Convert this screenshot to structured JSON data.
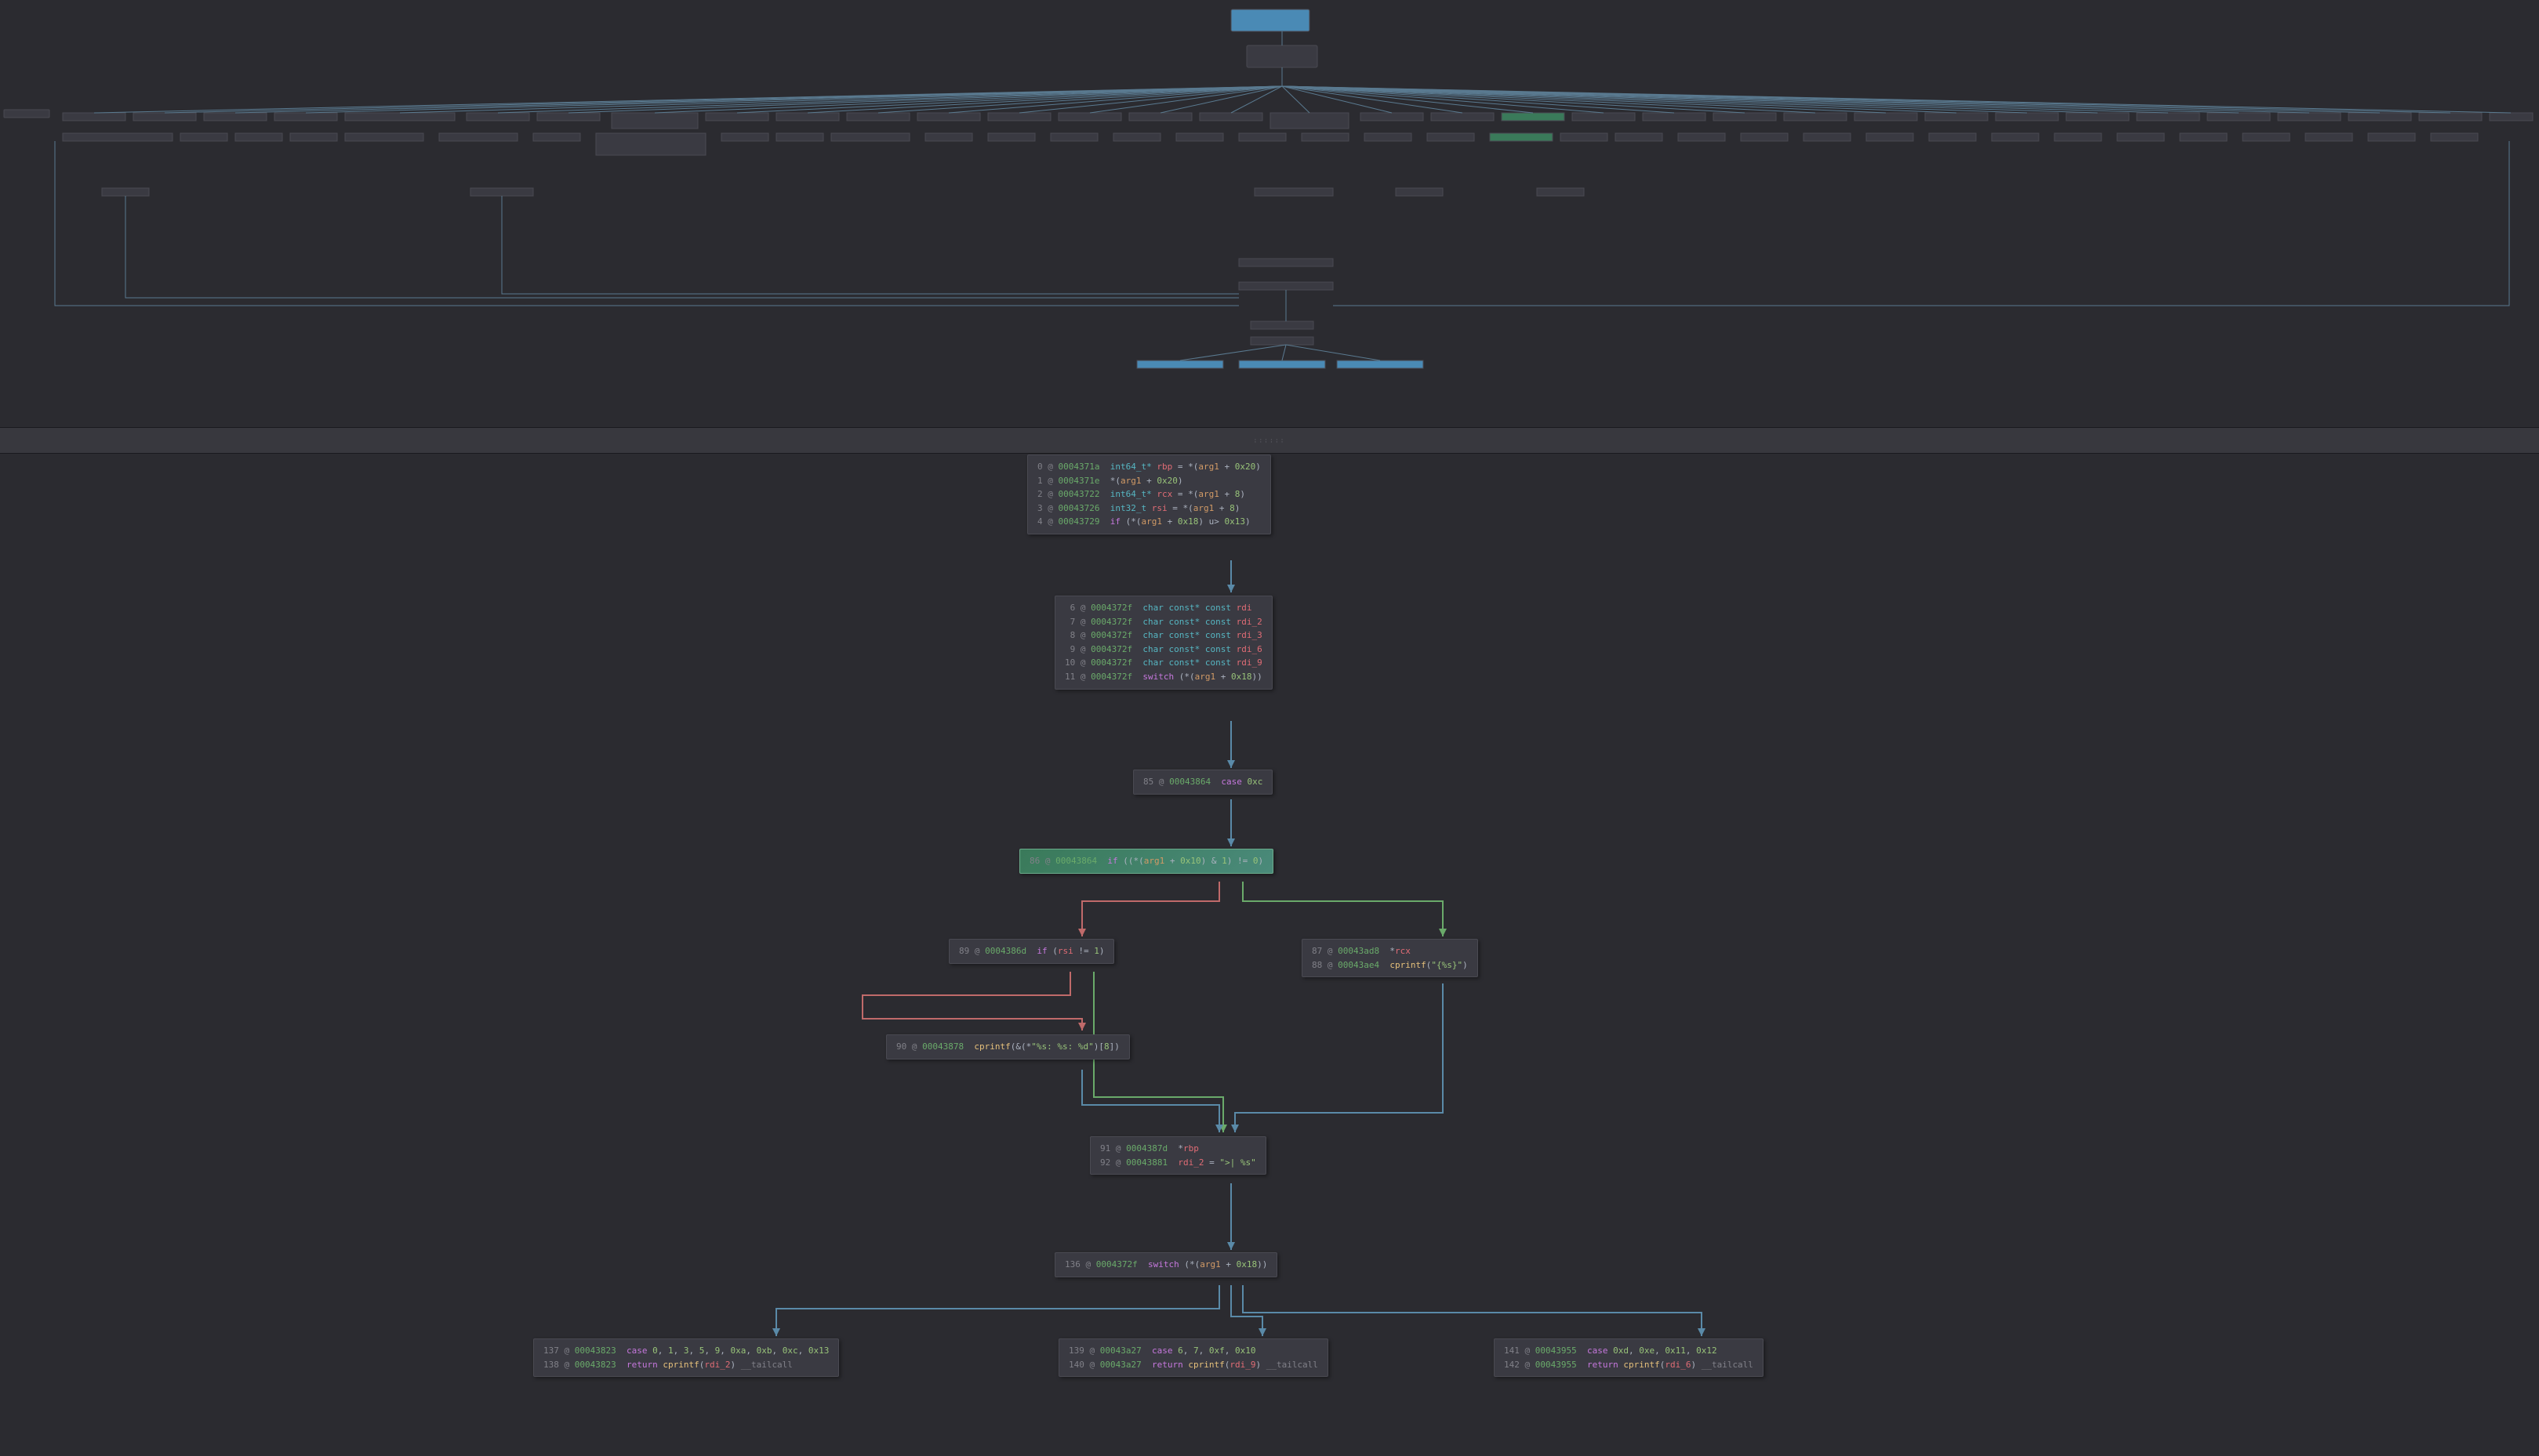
{
  "minimap": {
    "nodes_approx_count": 60,
    "highlighted_nodes": 2,
    "description": "overview graph with many small basic-block nodes and connecting edges at top of disassembler graph view"
  },
  "divider": {
    "handle_text": "::::::"
  },
  "blocks": {
    "b0": {
      "lines": [
        {
          "n": "0",
          "addr": "0004371a",
          "rest": [
            "int64_t* ",
            "rbp",
            " = *(",
            "arg1",
            " + ",
            "0x20",
            ")"
          ]
        },
        {
          "n": "1",
          "addr": "0004371e",
          "rest": [
            "*(",
            "arg1",
            " + ",
            "0x20",
            ")"
          ]
        },
        {
          "n": "2",
          "addr": "00043722",
          "rest": [
            "int64_t* ",
            "rcx",
            " = *(",
            "arg1",
            " + ",
            "8",
            ")"
          ]
        },
        {
          "n": "3",
          "addr": "00043726",
          "rest": [
            "int32_t ",
            "rsi",
            " = *(",
            "arg1",
            " + ",
            "8",
            ")"
          ]
        },
        {
          "n": "4",
          "addr": "00043729",
          "rest": [
            "if",
            " (*(",
            "arg1",
            " + ",
            "0x18",
            ") u> ",
            "0x13",
            ")"
          ]
        }
      ]
    },
    "b1": {
      "lines": [
        {
          "n": "6",
          "addr": "0004372f",
          "rest": [
            "char const* const ",
            "rdi"
          ]
        },
        {
          "n": "7",
          "addr": "0004372f",
          "rest": [
            "char const* const ",
            "rdi_2"
          ]
        },
        {
          "n": "8",
          "addr": "0004372f",
          "rest": [
            "char const* const ",
            "rdi_3"
          ]
        },
        {
          "n": "9",
          "addr": "0004372f",
          "rest": [
            "char const* const ",
            "rdi_6"
          ]
        },
        {
          "n": "10",
          "addr": "0004372f",
          "rest": [
            "char const* const ",
            "rdi_9"
          ]
        },
        {
          "n": "11",
          "addr": "0004372f",
          "rest": [
            "switch",
            " (*(",
            "arg1",
            " + ",
            "0x18",
            "))"
          ]
        }
      ]
    },
    "b2": {
      "lines": [
        {
          "n": "85",
          "addr": "00043864",
          "rest": [
            "case ",
            "0xc"
          ]
        }
      ]
    },
    "b3": {
      "lines": [
        {
          "n": "86",
          "addr": "00043864",
          "rest": [
            "if",
            " ((*(",
            "arg1",
            " + ",
            "0x10",
            ") & ",
            "1",
            ") != ",
            "0",
            ")"
          ]
        }
      ],
      "selected": true
    },
    "b4": {
      "lines": [
        {
          "n": "89",
          "addr": "0004386d",
          "rest": [
            "if",
            " (",
            "rsi",
            " != ",
            "1",
            ")"
          ]
        }
      ]
    },
    "b5": {
      "lines": [
        {
          "n": "87",
          "addr": "00043ad8",
          "rest": [
            "*",
            "rcx"
          ]
        },
        {
          "n": "88",
          "addr": "00043ae4",
          "rest": [
            "cprintf",
            "(",
            "\"{%s}\"",
            ")"
          ]
        }
      ]
    },
    "b6": {
      "lines": [
        {
          "n": "90",
          "addr": "00043878",
          "rest": [
            "cprintf",
            "(&(*",
            "\"%s: %s: %d\"",
            ")[",
            "8",
            "])"
          ]
        }
      ]
    },
    "b7": {
      "lines": [
        {
          "n": "91",
          "addr": "0004387d",
          "rest": [
            "*",
            "rbp"
          ]
        },
        {
          "n": "92",
          "addr": "00043881",
          "rest": [
            "rdi_2",
            " = ",
            "\">| %s\""
          ]
        }
      ]
    },
    "b8": {
      "lines": [
        {
          "n": "136",
          "addr": "0004372f",
          "rest": [
            "switch",
            " (*(",
            "arg1",
            " + ",
            "0x18",
            "))"
          ]
        }
      ]
    },
    "b9": {
      "lines": [
        {
          "n": "137",
          "addr": "00043823",
          "rest": [
            "case ",
            "0",
            ", ",
            "1",
            ", ",
            "3",
            ", ",
            "5",
            ", ",
            "9",
            ", ",
            "0xa",
            ", ",
            "0xb",
            ", ",
            "0xc",
            ", ",
            "0x13"
          ]
        },
        {
          "n": "138",
          "addr": "00043823",
          "rest": [
            "return ",
            "cprintf",
            "(",
            "rdi_2",
            ") ",
            "__tailcall"
          ]
        }
      ]
    },
    "b10": {
      "lines": [
        {
          "n": "139",
          "addr": "00043a27",
          "rest": [
            "case ",
            "6",
            ", ",
            "7",
            ", ",
            "0xf",
            ", ",
            "0x10"
          ]
        },
        {
          "n": "140",
          "addr": "00043a27",
          "rest": [
            "return ",
            "cprintf",
            "(",
            "rdi_9",
            ") ",
            "__tailcall"
          ]
        }
      ]
    },
    "b11": {
      "lines": [
        {
          "n": "141",
          "addr": "00043955",
          "rest": [
            "case ",
            "0xd",
            ", ",
            "0xe",
            ", ",
            "0x11",
            ", ",
            "0x12"
          ]
        },
        {
          "n": "142",
          "addr": "00043955",
          "rest": [
            "return ",
            "cprintf",
            "(",
            "rdi_6",
            ") ",
            "__tailcall"
          ]
        }
      ]
    }
  }
}
